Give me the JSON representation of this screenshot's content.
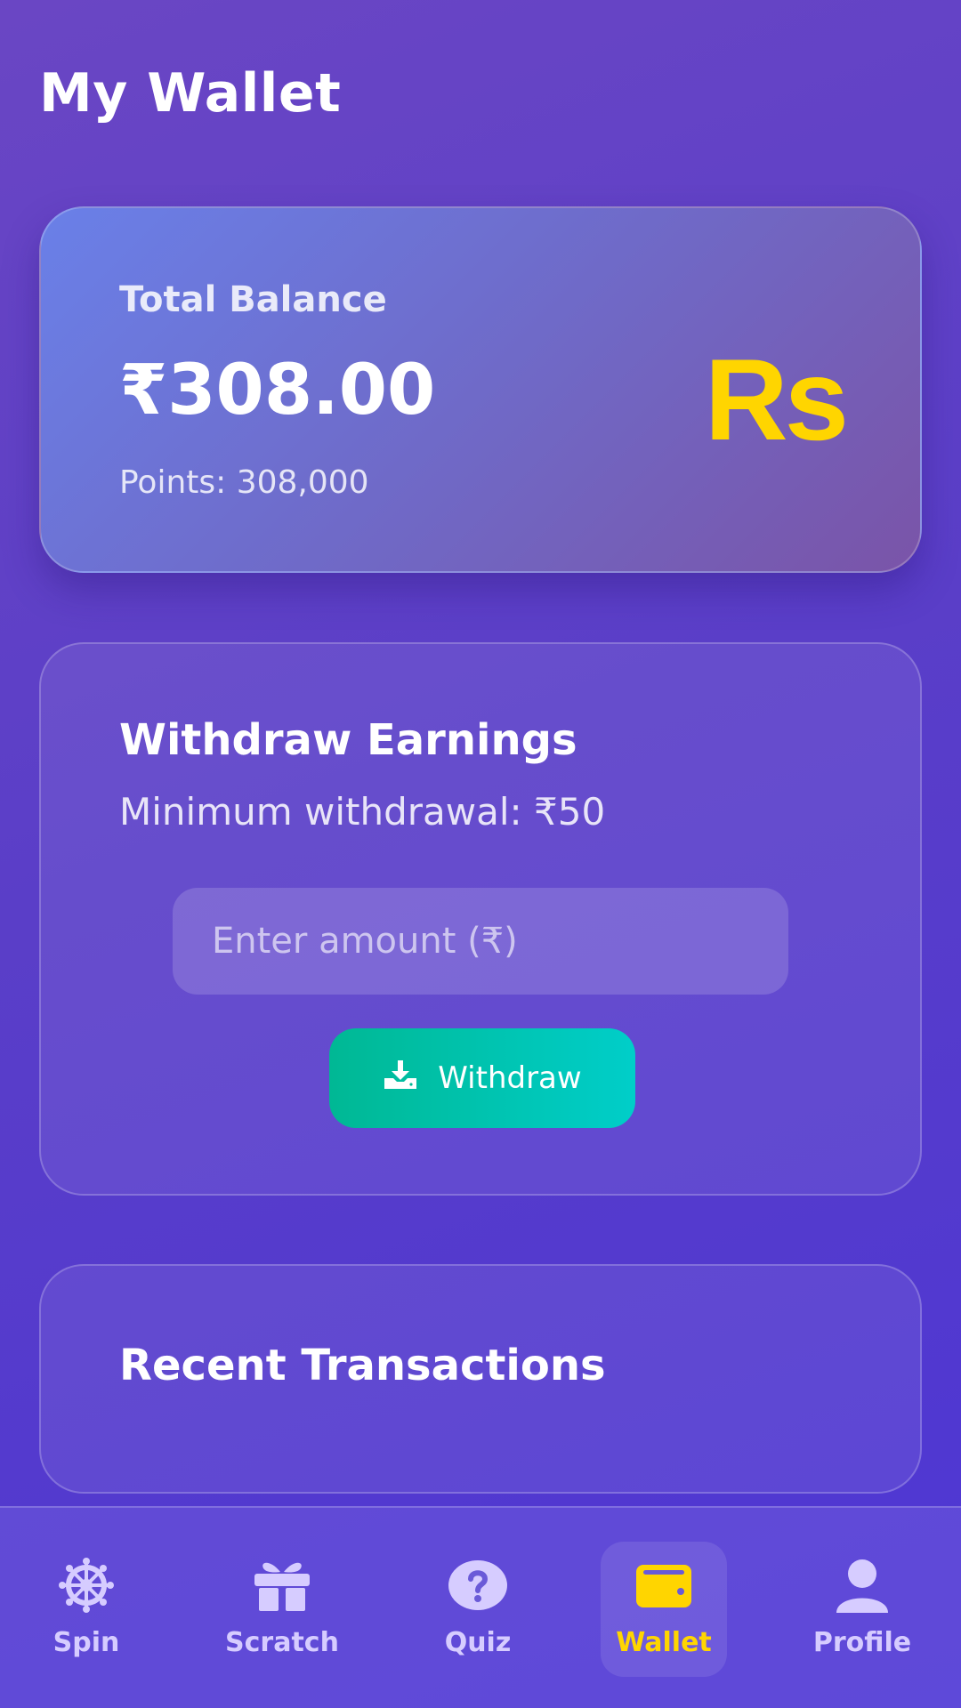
{
  "header": {
    "title": "My Wallet"
  },
  "balance": {
    "label": "Total Balance",
    "amount": "₹308.00",
    "points": "Points: 308,000",
    "icon_text": "Rs",
    "icon": "rupee-icon"
  },
  "withdraw": {
    "title": "Withdraw Earnings",
    "minimum": "Minimum withdrawal: ₹50",
    "amount_placeholder": "Enter amount (₹)",
    "amount_value": "",
    "button_label": "Withdraw",
    "button_icon": "download-icon"
  },
  "transactions": {
    "title": "Recent Transactions"
  },
  "nav": {
    "items": [
      {
        "label": "Spin",
        "icon": "wheel-icon",
        "active": false
      },
      {
        "label": "Scratch",
        "icon": "gift-icon",
        "active": false
      },
      {
        "label": "Quiz",
        "icon": "question-icon",
        "active": false
      },
      {
        "label": "Wallet",
        "icon": "wallet-icon",
        "active": true
      },
      {
        "label": "Profile",
        "icon": "user-icon",
        "active": false
      }
    ]
  },
  "colors": {
    "accent": "#ffd500",
    "button_start": "#00b894",
    "button_end": "#00cec9",
    "background": "#5a3ec8",
    "nav_inactive": "#d6ccff"
  }
}
